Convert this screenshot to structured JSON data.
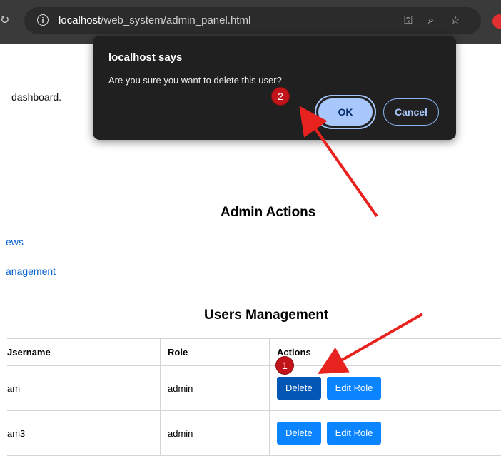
{
  "browser": {
    "url_host": "localhost",
    "url_path": "/web_system/admin_panel.html",
    "icons": [
      "info-icon",
      "key-icon",
      "zoom-icon",
      "star-icon"
    ]
  },
  "page": {
    "dashboard_text": "dashboard.",
    "admin_actions_heading": "Admin Actions",
    "link_views": "ews",
    "link_management": "anagement",
    "users_heading": "Users Management",
    "table": {
      "headers": [
        "Jsername",
        "Role",
        "Actions"
      ],
      "rows": [
        {
          "username": "am",
          "role": "admin"
        },
        {
          "username": "am3",
          "role": "admin"
        }
      ],
      "delete_label": "Delete",
      "edit_label": "Edit Role"
    }
  },
  "dialog": {
    "title": "localhost says",
    "message": "Are you sure you want to delete this user?",
    "ok_label": "OK",
    "cancel_label": "Cancel"
  },
  "annotations": {
    "badge_1": "1",
    "badge_2": "2",
    "arrow_color": "#e8231f"
  },
  "colors": {
    "primary_button": "#0a84ff",
    "link": "#0a63d6",
    "dialog_bg": "#202020"
  }
}
